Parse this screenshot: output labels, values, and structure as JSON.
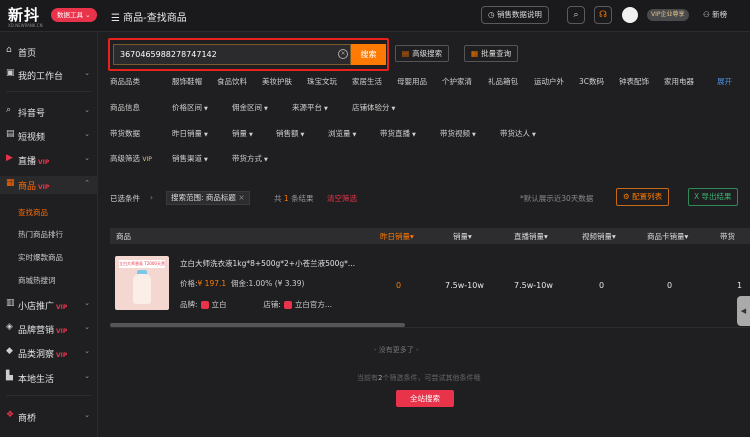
{
  "app": {
    "logo": "新抖",
    "logo_sub": "XD.NEWRANK.CN",
    "data_tools": "数据工具 ⌄"
  },
  "header": {
    "breadcrumb": "商品-查找商品",
    "sales_explain": "销售数据说明",
    "vip_label": "VIP企业尊享",
    "newbie": "新榜"
  },
  "sidebar": {
    "items": [
      {
        "label": "首页",
        "icon": "home-icon"
      },
      {
        "label": "我的工作台",
        "icon": "dashboard-icon"
      },
      {
        "label": "抖音号",
        "icon": "search-icon"
      },
      {
        "label": "短视频",
        "icon": "video-icon"
      },
      {
        "label": "直播",
        "icon": "live-icon",
        "vip": "VIP"
      },
      {
        "label": "商品",
        "icon": "cart-icon",
        "vip": "VIP"
      },
      {
        "label": "小店推广",
        "icon": "store-icon",
        "vip": "VIP"
      },
      {
        "label": "品牌营销",
        "icon": "brand-icon",
        "vip": "VIP"
      },
      {
        "label": "品类洞察",
        "icon": "category-icon",
        "vip": "VIP"
      },
      {
        "label": "本地生活",
        "icon": "local-icon"
      },
      {
        "label": "商桥",
        "icon": "bridge-icon"
      }
    ],
    "sub_items": [
      "查找商品",
      "热门商品排行",
      "实时爆款商品",
      "商城热搜词"
    ]
  },
  "search": {
    "value": "3670465988278747142",
    "button": "搜索",
    "advanced": "高级搜索",
    "batch": "批量查询"
  },
  "filters": {
    "category": {
      "title": "商品品类",
      "options": [
        "服饰鞋帽",
        "食品饮料",
        "美妆护肤",
        "珠宝文玩",
        "家居生活",
        "母婴用品",
        "个护家清",
        "礼品箱包",
        "运动户外",
        "3C数码",
        "钟表配饰",
        "家用电器"
      ],
      "expand": "展开"
    },
    "info": {
      "title": "商品信息",
      "options": [
        "价格区间",
        "佣金区间",
        "来源平台",
        "店铺体验分"
      ]
    },
    "sales": {
      "title": "带货数据",
      "options": [
        "昨日销量",
        "销量",
        "销售额",
        "浏览量",
        "带货直播",
        "带货视频",
        "带货达人"
      ]
    },
    "advanced": {
      "title": "高级筛选",
      "vip": "VIP",
      "options": [
        "销售渠道",
        "带货方式"
      ]
    }
  },
  "selection": {
    "label": "已选条件",
    "chip": "搜索范围: 商品标题",
    "count_prefix": "共",
    "count_num": "1",
    "count_suffix": "条结果",
    "clear": "清空筛选",
    "default_note": "*默认展示近30天数据",
    "config": "配置列表",
    "export": "导出结果"
  },
  "table": {
    "headers": [
      "商品",
      "昨日销量",
      "销量",
      "直播销量",
      "视频销量",
      "商品卡销量",
      "带货"
    ],
    "row": {
      "name": "立白大师洗衣液1kg*8+500g*2+小苍兰液500g*...",
      "price_label": "价格:",
      "price": "¥ 197.1",
      "commission": "佣金:1.00% (¥ 3.39)",
      "brand_label": "品牌:",
      "brand": "立白",
      "shop_label": "店铺:",
      "shop": "立白官方...",
      "yesterday_sales": "0",
      "sales": "7.5w-10w",
      "live_sales": "7.5w-10w",
      "video_sales": "0",
      "card_sales": "0",
      "extra": "1",
      "thumb_label": "立白大师香氛 T2000天然"
    }
  },
  "footer": {
    "no_more": "- 没有更多了 -",
    "hint_prefix": "当前有",
    "hint_num": "2",
    "hint_suffix": "个筛选条件，可尝试其他条件哦",
    "all_search": "全站搜索"
  }
}
